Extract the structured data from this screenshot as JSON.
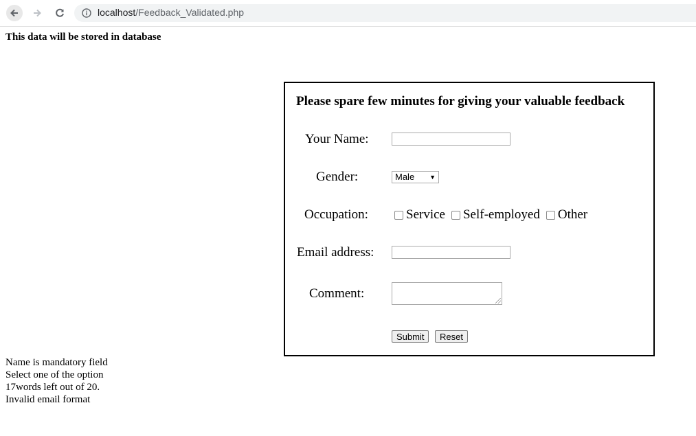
{
  "browser": {
    "url_host": "localhost",
    "url_path": "/Feedback_Validated.php"
  },
  "page": {
    "heading": "This data will be stored in database"
  },
  "form": {
    "title": "Please spare few minutes for giving your valuable feedback",
    "name_label": "Your Name:",
    "name_value": "",
    "gender_label": "Gender:",
    "gender_selected": "Male",
    "occupation_label": "Occupation:",
    "occupation_options": [
      "Service",
      "Self-employed",
      "Other"
    ],
    "email_label": "Email address:",
    "email_value": "",
    "comment_label": "Comment:",
    "submit_label": "Submit",
    "reset_label": "Reset"
  },
  "errors": [
    "Name is mandatory field",
    "Select one of the option",
    "17words left out of 20.",
    "Invalid email format"
  ]
}
